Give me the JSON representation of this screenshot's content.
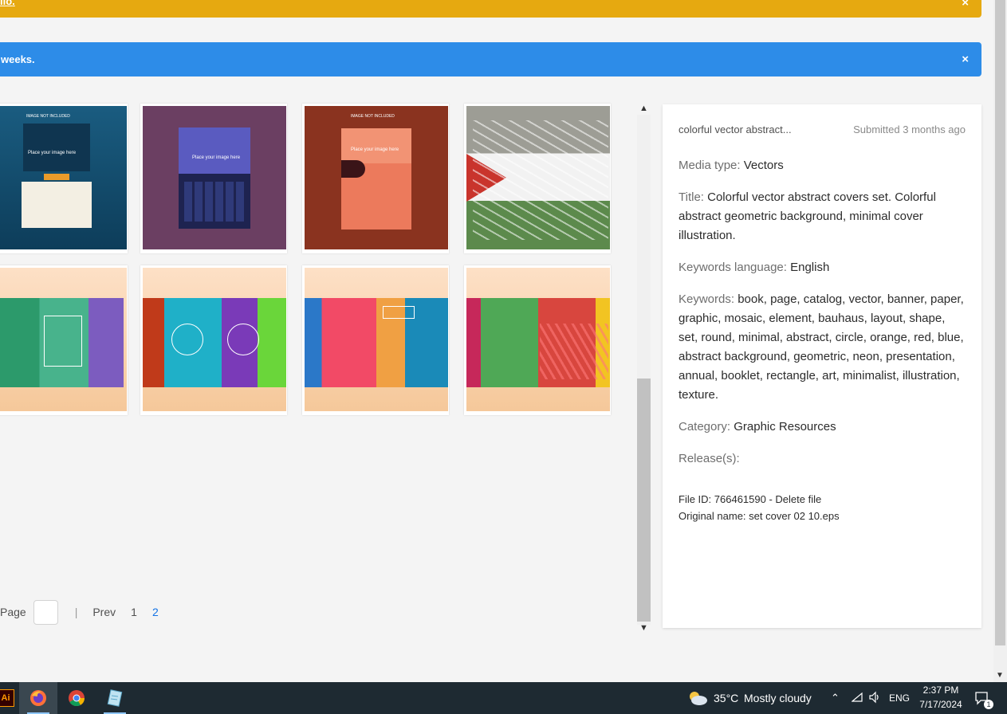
{
  "banners": {
    "yellow_text": "llo",
    "yellow_suffix": ".",
    "blue_text": "weeks.",
    "close_glyph": "×"
  },
  "thumbnails": [
    {
      "label": "IMAGE NOT INCLUDED",
      "sub": "Place your image here"
    },
    {
      "label": "",
      "sub": "Place your image here"
    },
    {
      "label": "IMAGE NOT INCLUDED",
      "sub": "Place your image here"
    },
    {
      "label": "",
      "sub": ""
    },
    {
      "label": "",
      "sub": ""
    },
    {
      "label": "",
      "sub": ""
    },
    {
      "label": "",
      "sub": ""
    },
    {
      "label": "",
      "sub": ""
    }
  ],
  "details": {
    "file_name": "colorful vector abstract...",
    "submitted": "Submitted 3 months ago",
    "media_type_label": "Media type:",
    "media_type": "Vectors",
    "title_label": "Title:",
    "title": "Colorful vector abstract covers set. Colorful abstract geometric background, minimal cover illustration.",
    "keywords_language_label": "Keywords language:",
    "keywords_language": "English",
    "keywords_label": "Keywords:",
    "keywords": "book, page, catalog, vector, banner, paper, graphic, mosaic, element, bauhaus, layout, shape, set, round, minimal, abstract, circle, orange, red, blue, abstract background, geometric, neon, presentation, annual, booklet, rectangle, art, minimalist, illustration, texture.",
    "category_label": "Category:",
    "category": "Graphic Resources",
    "releases_label": "Release(s):",
    "file_id_line_prefix": "File ID: 766461590 - ",
    "delete_file": "Delete file",
    "original_name": "Original name: set cover 02 10.eps"
  },
  "pager": {
    "page_label": "Page",
    "separator": "|",
    "prev": "Prev",
    "page1": "1",
    "page2": "2"
  },
  "taskbar": {
    "temperature": "35°C",
    "weather": "Mostly cloudy",
    "language": "ENG",
    "time": "2:37 PM",
    "date": "7/17/2024",
    "notification_count": "1",
    "apps": [
      "adobe-illustrator",
      "firefox",
      "chrome",
      "notepad"
    ]
  },
  "colors": {
    "yellow_banner": "#e6a910",
    "blue_banner": "#2d8ce8",
    "link_blue": "#1473e6",
    "taskbar": "#1e2a32"
  }
}
